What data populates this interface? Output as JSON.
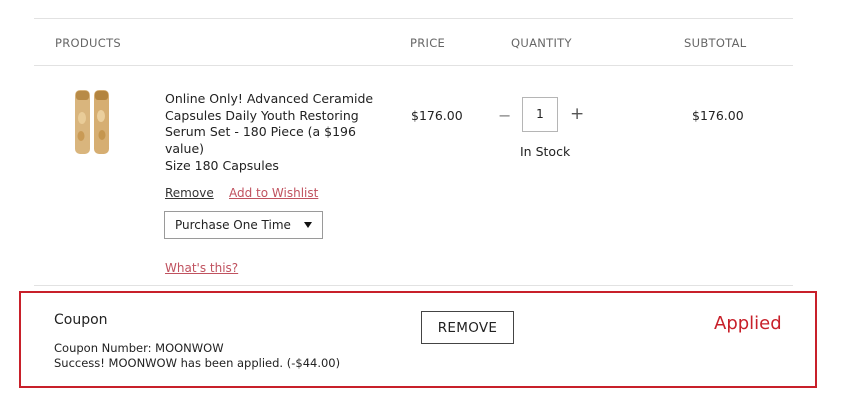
{
  "table": {
    "headers": {
      "products": "PRODUCTS",
      "price": "PRICE",
      "quantity": "QUANTITY",
      "subtotal": "SUBTOTAL"
    }
  },
  "item": {
    "name": "Online Only! Advanced Ceramide Capsules Daily Youth Restoring Serum Set - 180 Piece (a $196 value)",
    "size": "Size 180 Capsules",
    "remove_label": "Remove",
    "wishlist_label": "Add to Wishlist",
    "purchase_option": "Purchase One Time",
    "whats_this": "What's this?",
    "price": "$176.00",
    "quantity": "1",
    "minus_symbol": "−",
    "plus_symbol": "+",
    "stock": "In Stock",
    "subtotal": "$176.00"
  },
  "coupon": {
    "title": "Coupon",
    "number_line": "Coupon Number: MOONWOW",
    "success_line": "Success! MOONWOW has been applied. (-$44.00)",
    "remove_label": "REMOVE",
    "applied_label": "Applied"
  },
  "colors": {
    "accent_red": "#c8202a",
    "link_red": "#c0525f"
  }
}
